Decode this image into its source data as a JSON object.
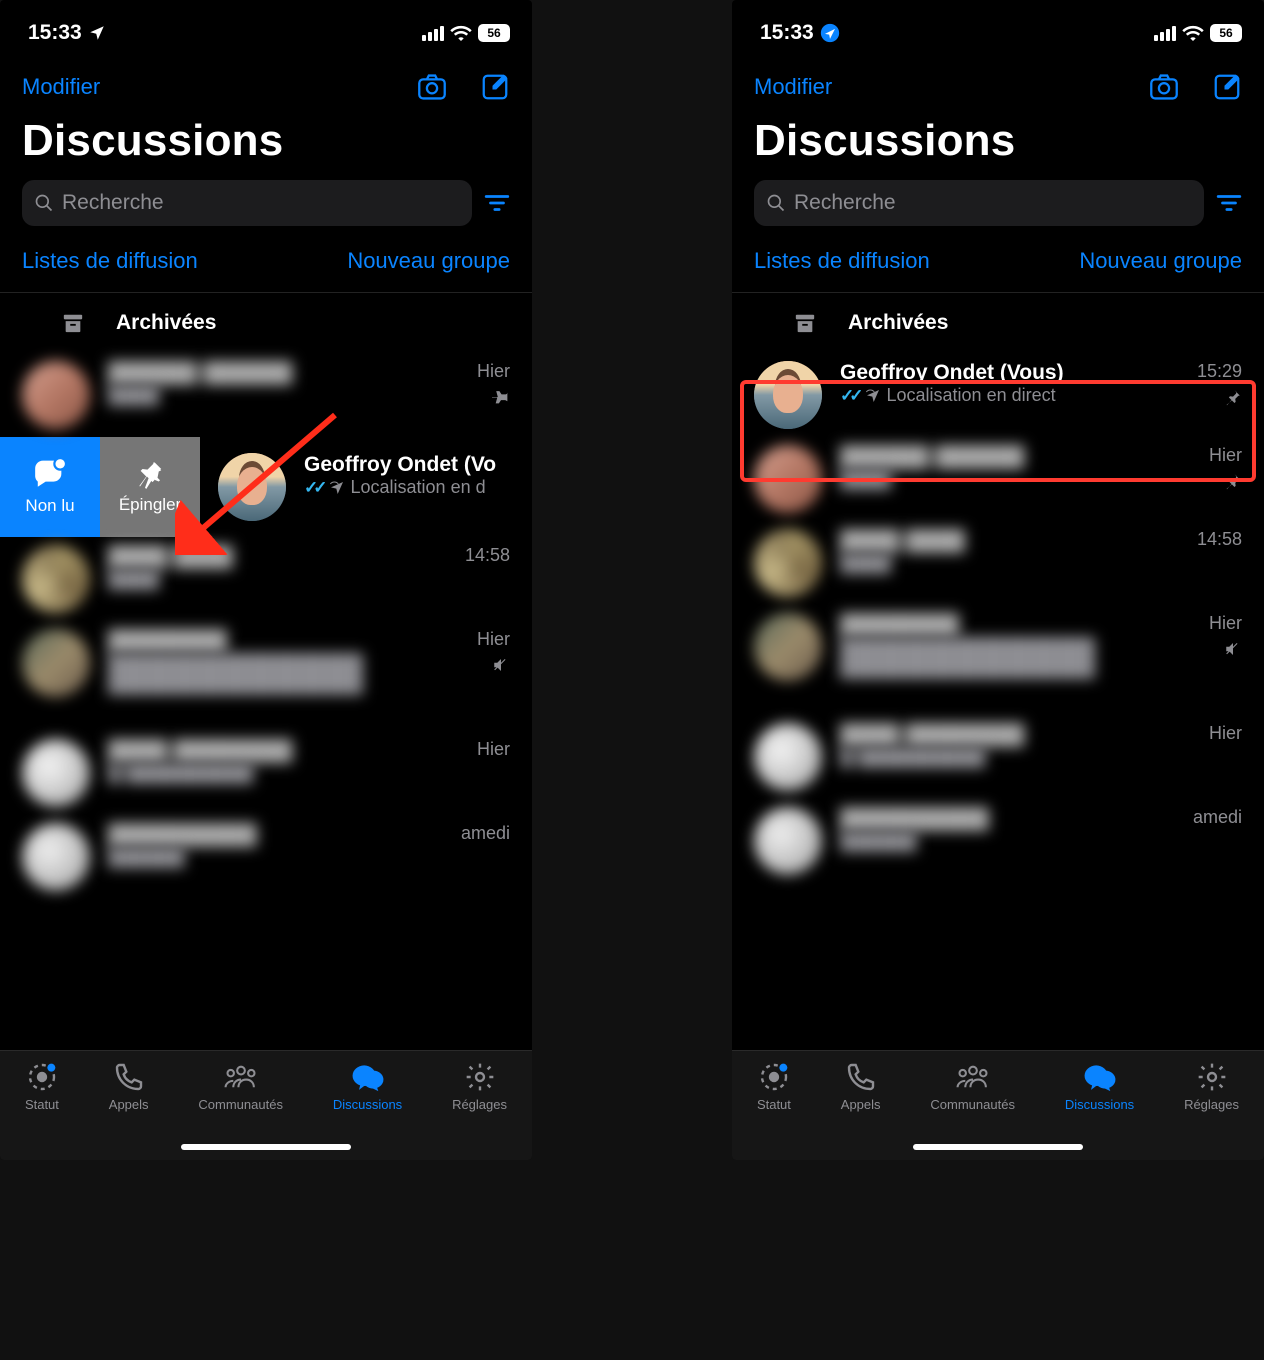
{
  "status": {
    "time": "15:33",
    "battery": "56"
  },
  "header": {
    "edit": "Modifier",
    "title": "Discussions"
  },
  "search": {
    "placeholder": "Recherche"
  },
  "sublinks": {
    "broadcast": "Listes de diffusion",
    "newgroup": "Nouveau groupe"
  },
  "archived": {
    "label": "Archivées"
  },
  "swipe": {
    "unread": "Non lu",
    "pin": "Épingler"
  },
  "geoff": {
    "name_short": "Geoffroy Ondet (Vo",
    "name_full": "Geoffroy Ondet (Vous)",
    "sub_short": "Localisation en d",
    "sub_full": "Localisation en direct",
    "time": "15:29"
  },
  "rows_left": [
    {
      "time": "Hier",
      "pin": true
    },
    {
      "time": "14:58"
    },
    {
      "time": "Hier",
      "mute": true
    },
    {
      "time": "Hier"
    },
    {
      "time": "amedi"
    }
  ],
  "rows_right": [
    {
      "time": "Hier",
      "pin": true
    },
    {
      "time": "14:58"
    },
    {
      "time": "Hier",
      "mute": true
    },
    {
      "time": "Hier"
    },
    {
      "time": "amedi"
    }
  ],
  "tabs": {
    "status": "Statut",
    "calls": "Appels",
    "communities": "Communautés",
    "discussions": "Discussions",
    "settings": "Réglages"
  }
}
